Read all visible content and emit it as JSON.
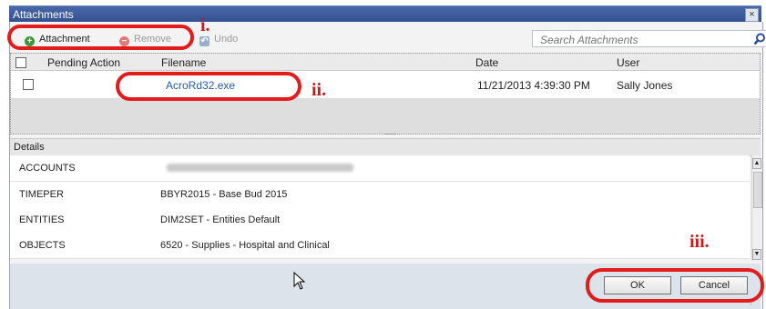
{
  "window": {
    "title": "Attachments",
    "close_glyph": "×"
  },
  "toolbar": {
    "attachment_label": "Attachment",
    "remove_label": "Remove",
    "undo_label": "Undo",
    "search_placeholder": "Search Attachments"
  },
  "grid": {
    "columns": [
      "Pending Action",
      "Filename",
      "Date",
      "User"
    ],
    "rows": [
      {
        "filename": "AcroRd32.exe",
        "date": "11/21/2013 4:39:30 PM",
        "user": "Sally Jones"
      }
    ]
  },
  "details": {
    "header": "Details",
    "rows": [
      {
        "key": "ACCOUNTS",
        "value": ""
      },
      {
        "key": "TIMEPER",
        "value": "BBYR2015 - Base Bud 2015"
      },
      {
        "key": "ENTITIES",
        "value": "DIM2SET - Entities Default"
      },
      {
        "key": "OBJECTS",
        "value": "6520 - Supplies - Hospital and Clinical"
      }
    ]
  },
  "buttons": {
    "ok": "OK",
    "cancel": "Cancel"
  },
  "annotations": {
    "one": "i.",
    "two": "ii.",
    "three": "iii."
  },
  "colors": {
    "annotation": "#e21b1b",
    "titlebar": "#3b5799",
    "link": "#2a5aa8"
  }
}
